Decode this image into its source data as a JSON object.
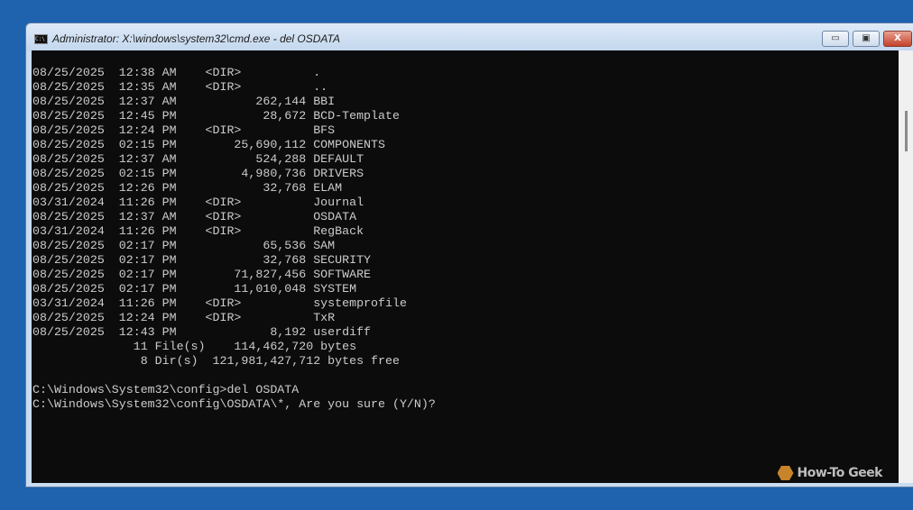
{
  "window": {
    "title": "Administrator: X:\\windows\\system32\\cmd.exe - del  OSDATA",
    "buttons": {
      "minimize": "▭",
      "maximize": "▣",
      "close": "X"
    }
  },
  "console": {
    "lines": [
      "08/25/2025  12:38 AM    <DIR>          .",
      "08/25/2025  12:35 AM    <DIR>          ..",
      "08/25/2025  12:37 AM           262,144 BBI",
      "08/25/2025  12:45 PM            28,672 BCD-Template",
      "08/25/2025  12:24 PM    <DIR>          BFS",
      "08/25/2025  02:15 PM        25,690,112 COMPONENTS",
      "08/25/2025  12:37 AM           524,288 DEFAULT",
      "08/25/2025  02:15 PM         4,980,736 DRIVERS",
      "08/25/2025  12:26 PM            32,768 ELAM",
      "03/31/2024  11:26 PM    <DIR>          Journal",
      "08/25/2025  12:37 AM    <DIR>          OSDATA",
      "03/31/2024  11:26 PM    <DIR>          RegBack",
      "08/25/2025  02:17 PM            65,536 SAM",
      "08/25/2025  02:17 PM            32,768 SECURITY",
      "08/25/2025  02:17 PM        71,827,456 SOFTWARE",
      "08/25/2025  02:17 PM        11,010,048 SYSTEM",
      "03/31/2024  11:26 PM    <DIR>          systemprofile",
      "08/25/2025  12:24 PM    <DIR>          TxR",
      "08/25/2025  12:43 PM             8,192 userdiff",
      "              11 File(s)    114,462,720 bytes",
      "               8 Dir(s)  121,981,427,712 bytes free",
      "",
      "C:\\Windows\\System32\\config>del OSDATA",
      "C:\\Windows\\System32\\config\\OSDATA\\*, Are you sure (Y/N)?"
    ]
  },
  "watermark": {
    "text": "How-To Geek"
  }
}
